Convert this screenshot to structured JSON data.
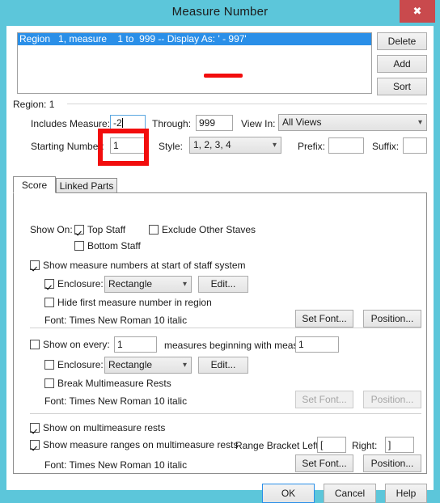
{
  "window": {
    "title": "Measure Number",
    "close_label": "✖"
  },
  "region_list": {
    "items": [
      "Region   1, measure    1 to  999 -- Display As: ' - 997'"
    ]
  },
  "list_buttons": {
    "delete": "Delete",
    "add": "Add",
    "sort": "Sort"
  },
  "region": {
    "header": "Region: 1",
    "includes_measure_label": "Includes Measure:",
    "includes_measure_value": "-2",
    "through_label": "Through:",
    "through_value": "999",
    "view_in_label": "View In:",
    "view_in_value": "All Views",
    "starting_number_label": "Starting Number:",
    "starting_number_value": "1",
    "style_label": "Style:",
    "style_value": "1, 2, 3, 4",
    "prefix_label": "Prefix:",
    "prefix_value": "",
    "suffix_label": "Suffix:",
    "suffix_value": ""
  },
  "tabs": [
    {
      "label": "Score",
      "active": true
    },
    {
      "label": "Linked Parts",
      "active": false
    }
  ],
  "score_panel": {
    "show_on_label": "Show On:",
    "top_staff": "Top Staff",
    "exclude_other_staves": "Exclude Other Staves",
    "bottom_staff": "Bottom Staff",
    "show_at_start": "Show measure numbers at start of staff system",
    "enclosure_label_1": "Enclosure:",
    "enclosure_value_1": "Rectangle",
    "edit_1": "Edit...",
    "hide_first": "Hide first measure number in region",
    "font_1": "Font:  Times New Roman 10  italic",
    "set_font_1": "Set Font...",
    "position_1": "Position...",
    "show_on_every_label": "Show on every:",
    "show_on_every_value": "1",
    "measures_beginning_label": "measures beginning with measure:",
    "measures_beginning_value": "1",
    "enclosure_label_2": "Enclosure:",
    "enclosure_value_2": "Rectangle",
    "edit_2": "Edit...",
    "break_multimeasure": "Break Multimeasure Rests",
    "font_2": "Font:  Times New Roman 10  italic",
    "set_font_2": "Set Font...",
    "position_2": "Position...",
    "show_on_multimeasure": "Show on multimeasure rests",
    "show_ranges": "Show measure ranges on multimeasure rests",
    "range_bracket_left_label": "Range Bracket Left:",
    "range_bracket_left_value": "[",
    "range_bracket_right_label": "Right:",
    "range_bracket_right_value": "]",
    "font_3": "Font:  Times New Roman 10  italic",
    "set_font_3": "Set Font...",
    "position_3": "Position..."
  },
  "dialog_buttons": {
    "ok": "OK",
    "cancel": "Cancel",
    "help": "Help"
  },
  "annotations": {
    "underline_color": "#f20d0d",
    "rect_color": "#f20d0d"
  },
  "colors": {
    "titlebar": "#5cc6da",
    "close_button": "#c94a4d",
    "selection": "#2a8fe8"
  }
}
